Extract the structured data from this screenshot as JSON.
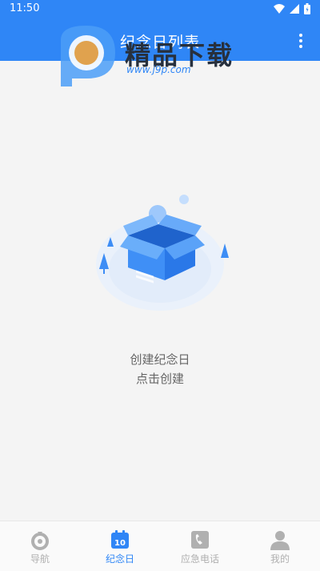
{
  "status_bar": {
    "time": "11:50"
  },
  "app_bar": {
    "title": "纪念日列表"
  },
  "watermark": {
    "text": "精品下载",
    "url": "www.j9p.com"
  },
  "empty_state": {
    "line1": "创建纪念日",
    "line2": "点击创建"
  },
  "bottom_nav": {
    "items": [
      {
        "label": "导航",
        "icon": "compass-icon",
        "active": false
      },
      {
        "label": "纪念日",
        "icon": "calendar-icon",
        "active": true
      },
      {
        "label": "应急电话",
        "icon": "phone-icon",
        "active": false
      },
      {
        "label": "我的",
        "icon": "person-icon",
        "active": false
      }
    ]
  },
  "colors": {
    "primary": "#2f86f6",
    "background": "#f4f4f4",
    "inactive": "#b0b0b0"
  }
}
